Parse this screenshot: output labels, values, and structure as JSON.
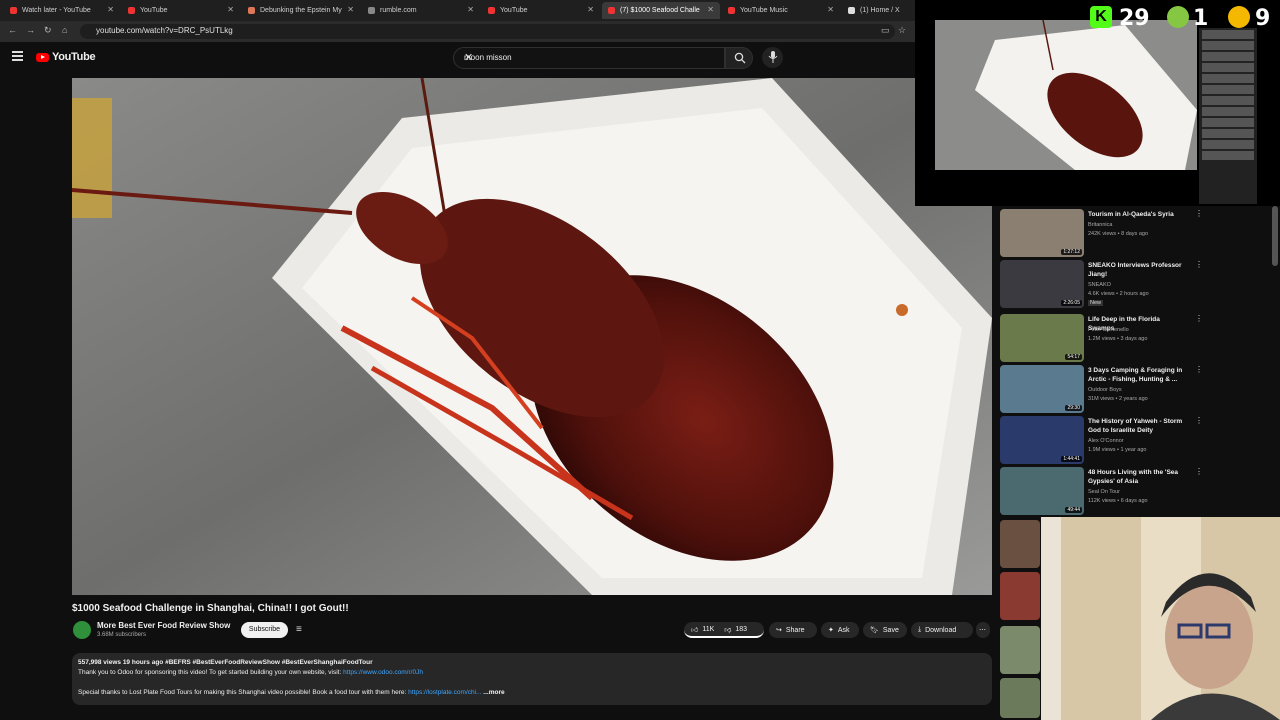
{
  "tabs": [
    {
      "label": "Watch later - YouTube",
      "fav": "#e33"
    },
    {
      "label": "YouTube",
      "fav": "#e33"
    },
    {
      "label": "Debunking the Epstein My",
      "fav": "#d75"
    },
    {
      "label": "rumble.com",
      "fav": "#888"
    },
    {
      "label": "YouTube",
      "fav": "#e33"
    },
    {
      "label": "(7) $1000 Seafood Challe",
      "fav": "#e33"
    },
    {
      "label": "YouTube Music",
      "fav": "#e33"
    },
    {
      "label": "(1) Home / X",
      "fav": "#ddd"
    }
  ],
  "browser": {
    "url": "youtube.com/watch?v=DRC_PsUTLkg"
  },
  "header": {
    "logo": "YouTube",
    "search_query": "moon misson"
  },
  "video": {
    "title": "$1000 Seafood Challenge in Shanghai, China!! I got Gout!!",
    "channel": "More Best Ever Food Review Show",
    "subscribers": "3.68M subscribers",
    "subscribe_label": "Subscribe",
    "likes": "11K",
    "dislikes": "183",
    "share_label": "Share",
    "ask_label": "Ask",
    "save_label": "Save",
    "download_label": "Download"
  },
  "description": {
    "stats": "557,998 views  19 hours ago  #BEFRS #BestEverFoodReviewShow #BestEverShanghaiFoodTour",
    "line1": "Thank you to Odoo for sponsoring this video! To get started building your own website, visit:",
    "line1_link": "https://www.odoo.com/r/0Jh",
    "line2": "Special thanks to Lost Plate Food Tours for making this Shanghai video possible! Book a food tour with them here:",
    "line2_link": "https://lostplate.com/chi...",
    "more": "...more"
  },
  "overlay": {
    "score1": "29",
    "score2": "1",
    "score3": "9"
  },
  "suggestions": [
    {
      "title": "Tourism in Al-Qaeda's Syria",
      "channel": "Britannica",
      "views": "242K views • 8 days ago",
      "duration": "1:27:12",
      "color": "#8a7f70"
    },
    {
      "title": "SNEAKO Interviews Professor Jiang!",
      "channel": "SNEAKO",
      "views": "4.6K views • 2 hours ago",
      "badge": "New",
      "duration": "2:26:05",
      "color": "#3a3a40"
    },
    {
      "title": "Life Deep in the Florida Swamps",
      "channel": "Peter Santenello",
      "views": "1.2M views • 3 days ago",
      "duration": "54:17",
      "color": "#6a7a4a"
    },
    {
      "title": "3 Days Camping & Foraging in Arctic - Fishing, Hunting & ...",
      "channel": "Outdoor Boys",
      "views": "31M views • 2 years ago",
      "duration": "29:30",
      "color": "#5a7a90"
    },
    {
      "title": "The History of Yahweh - Storm God to Israelite Deity",
      "channel": "Alex O'Connor",
      "views": "1.9M views • 1 year ago",
      "duration": "1:44:41",
      "color": "#2a3a6a"
    },
    {
      "title": "48 Hours Living with the 'Sea Gypsies' of Asia",
      "channel": "Seal On Tour",
      "views": "112K views • 6 days ago",
      "duration": "49:44",
      "color": "#4a6a70"
    }
  ]
}
